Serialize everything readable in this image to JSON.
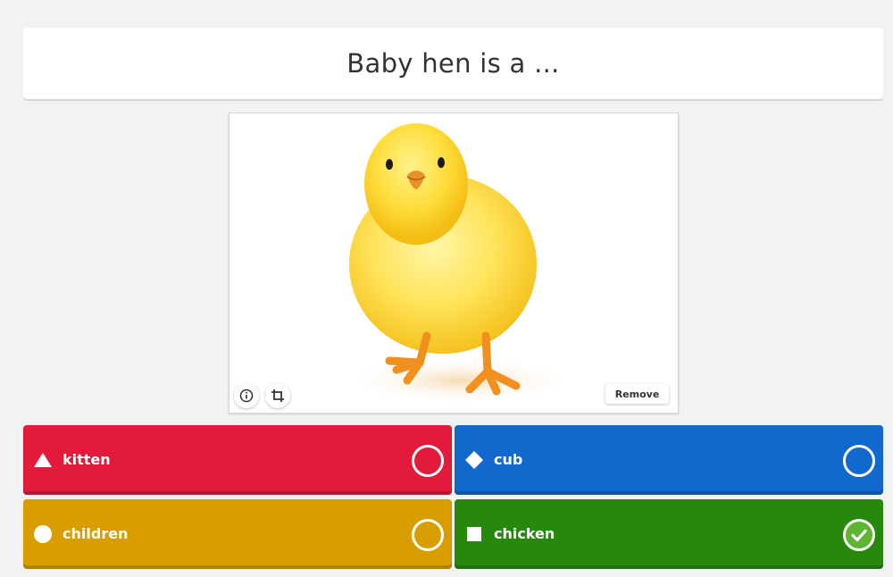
{
  "question": {
    "text": "Baby hen is a ..."
  },
  "media": {
    "remove_label": "Remove",
    "image_subject": "yellow chick"
  },
  "answers": [
    {
      "label": "kitten",
      "color": "#e21b3c",
      "shape": "triangle",
      "correct": false
    },
    {
      "label": "cub",
      "color": "#1368ce",
      "shape": "diamond",
      "correct": false
    },
    {
      "label": "children",
      "color": "#d89e00",
      "shape": "circle",
      "correct": false
    },
    {
      "label": "chicken",
      "color": "#26890c",
      "shape": "square",
      "correct": true
    }
  ]
}
